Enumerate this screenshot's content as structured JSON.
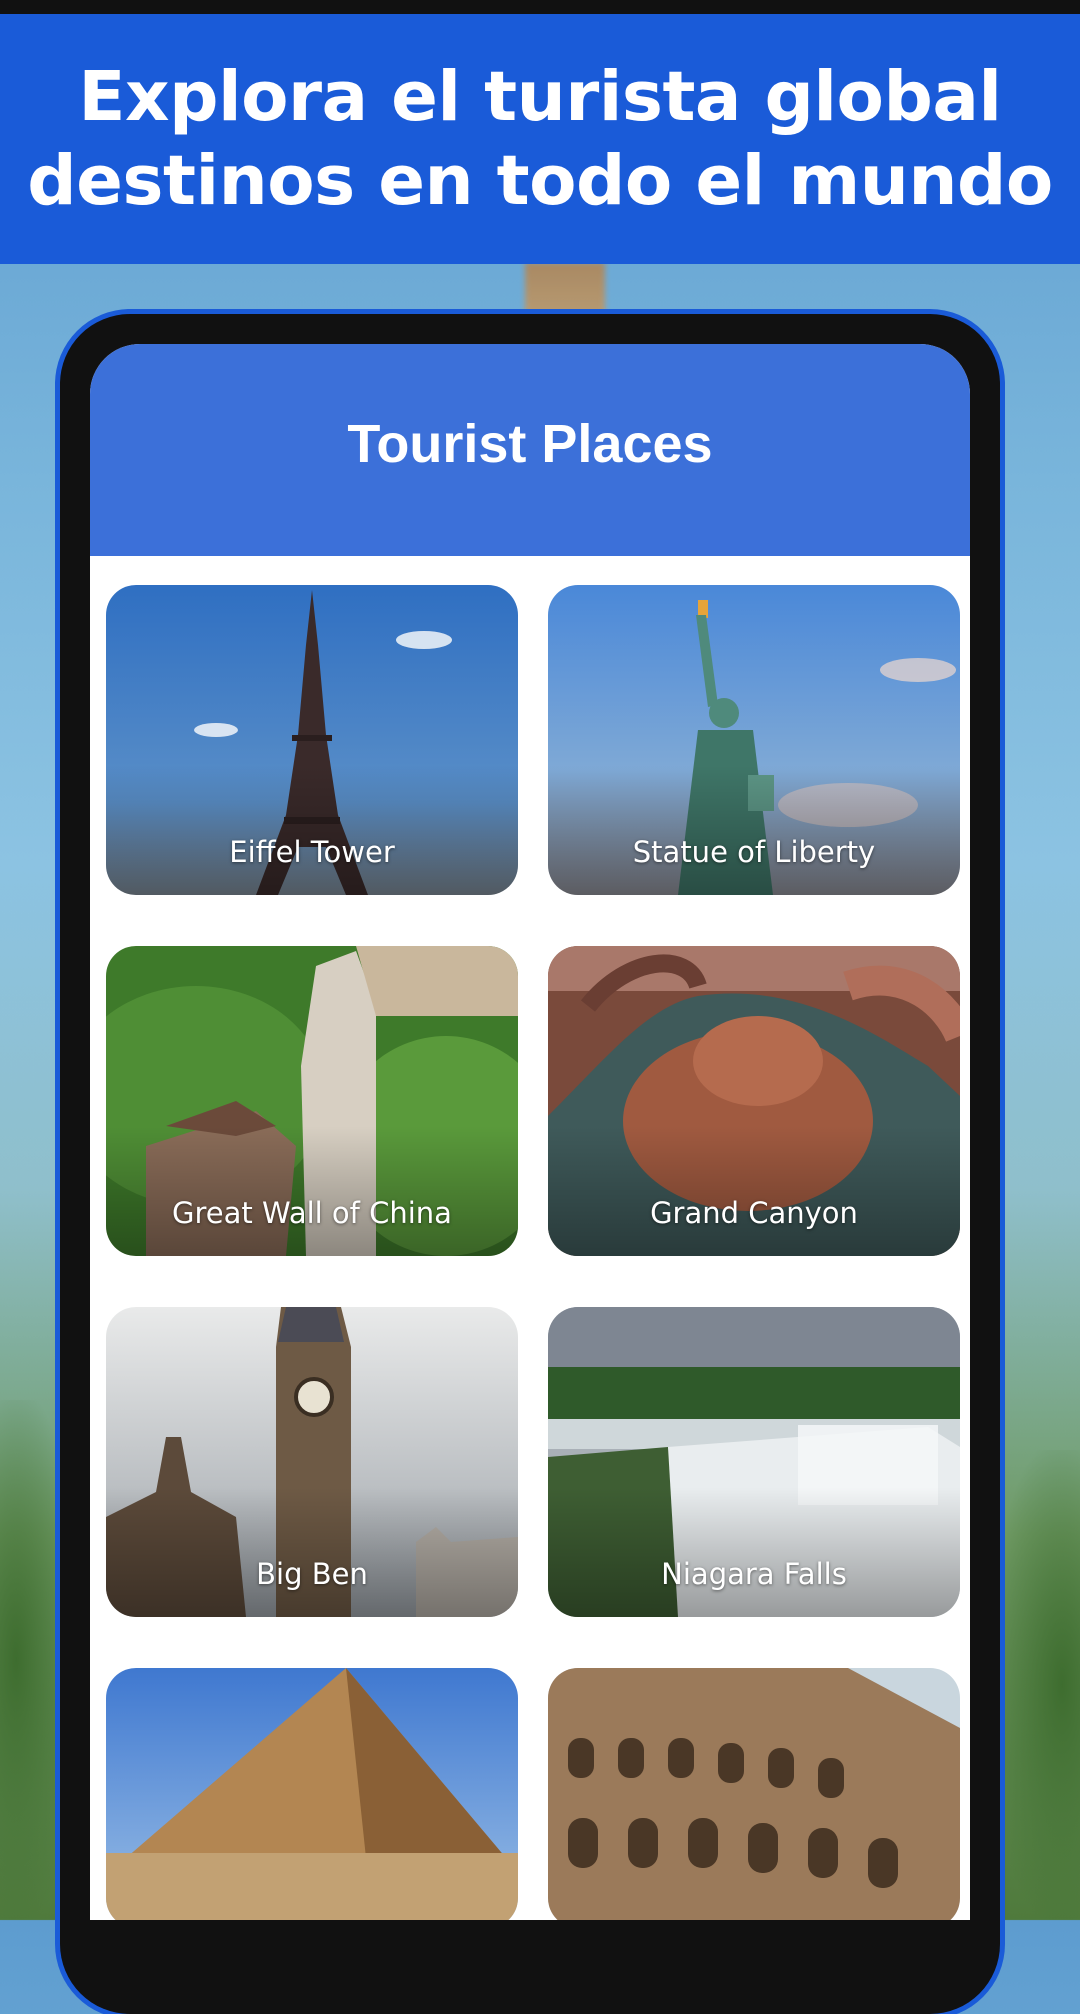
{
  "banner": {
    "line1": "Explora el turista global",
    "line2": "destinos en todo el mundo"
  },
  "app": {
    "title": "Tourist Places"
  },
  "places": [
    {
      "label": "Eiffel Tower",
      "icon": "eiffel-tower-photo"
    },
    {
      "label": "Statue of Liberty",
      "icon": "statue-of-liberty-photo"
    },
    {
      "label": "Great Wall of China",
      "icon": "great-wall-photo"
    },
    {
      "label": "Grand Canyon",
      "icon": "grand-canyon-photo"
    },
    {
      "label": "Big Ben",
      "icon": "big-ben-photo"
    },
    {
      "label": "Niagara Falls",
      "icon": "niagara-falls-photo"
    },
    {
      "label": "",
      "icon": "pyramid-photo"
    },
    {
      "label": "",
      "icon": "colosseum-photo"
    }
  ],
  "colors": {
    "banner": "#1a5bd8",
    "app_header": "#3c70d9",
    "phone_frame": "#111111"
  }
}
